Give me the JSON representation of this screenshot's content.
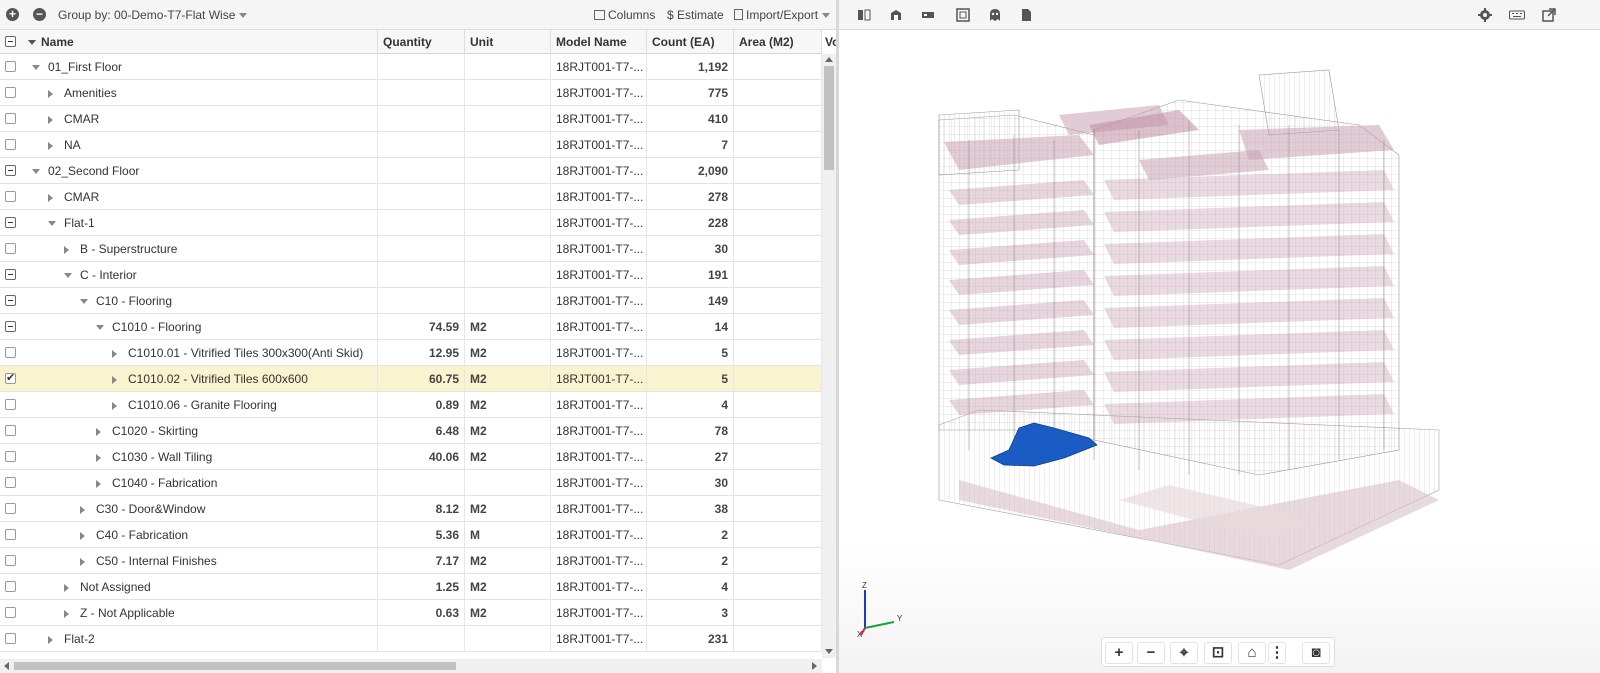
{
  "toolbar": {
    "group_by": "Group by: 00-Demo-T7-Flat Wise",
    "columns": "Columns",
    "estimate": "$ Estimate",
    "import_export": "Import/Export"
  },
  "headers": {
    "name": "Name",
    "quantity": "Quantity",
    "unit": "Unit",
    "model": "Model Name",
    "count": "Count (EA)",
    "area": "Area (M2)",
    "vol": "Vo"
  },
  "rows": [
    {
      "name": "01_First Floor",
      "qty": "",
      "unit": "",
      "model": "18RJT001-T7-...",
      "count": "1,192"
    },
    {
      "name": "Amenities",
      "qty": "",
      "unit": "",
      "model": "18RJT001-T7-...",
      "count": "775"
    },
    {
      "name": "CMAR",
      "qty": "",
      "unit": "",
      "model": "18RJT001-T7-...",
      "count": "410"
    },
    {
      "name": "NA",
      "qty": "",
      "unit": "",
      "model": "18RJT001-T7-...",
      "count": "7"
    },
    {
      "name": "02_Second Floor",
      "qty": "",
      "unit": "",
      "model": "18RJT001-T7-...",
      "count": "2,090"
    },
    {
      "name": "CMAR",
      "qty": "",
      "unit": "",
      "model": "18RJT001-T7-...",
      "count": "278"
    },
    {
      "name": "Flat-1",
      "qty": "",
      "unit": "",
      "model": "18RJT001-T7-...",
      "count": "228"
    },
    {
      "name": "B - Superstructure",
      "qty": "",
      "unit": "",
      "model": "18RJT001-T7-...",
      "count": "30"
    },
    {
      "name": "C - Interior",
      "qty": "",
      "unit": "",
      "model": "18RJT001-T7-...",
      "count": "191"
    },
    {
      "name": "C10 - Flooring",
      "qty": "",
      "unit": "",
      "model": "18RJT001-T7-...",
      "count": "149"
    },
    {
      "name": "C1010 - Flooring",
      "qty": "74.59",
      "unit": "M2",
      "model": "18RJT001-T7-...",
      "count": "14"
    },
    {
      "name": "C1010.01 - Vitrified Tiles 300x300(Anti Skid)",
      "qty": "12.95",
      "unit": "M2",
      "model": "18RJT001-T7-...",
      "count": "5"
    },
    {
      "name": "C1010.02 - Vitrified Tiles 600x600",
      "qty": "60.75",
      "unit": "M2",
      "model": "18RJT001-T7-...",
      "count": "5"
    },
    {
      "name": "C1010.06 - Granite Flooring",
      "qty": "0.89",
      "unit": "M2",
      "model": "18RJT001-T7-...",
      "count": "4"
    },
    {
      "name": "C1020 - Skirting",
      "qty": "6.48",
      "unit": "M2",
      "model": "18RJT001-T7-...",
      "count": "78"
    },
    {
      "name": "C1030 - Wall Tiling",
      "qty": "40.06",
      "unit": "M2",
      "model": "18RJT001-T7-...",
      "count": "27"
    },
    {
      "name": "C1040 - Fabrication",
      "qty": "",
      "unit": "",
      "model": "18RJT001-T7-...",
      "count": "30"
    },
    {
      "name": "C30 - Door&Window",
      "qty": "8.12",
      "unit": "M2",
      "model": "18RJT001-T7-...",
      "count": "38"
    },
    {
      "name": "C40 - Fabrication",
      "qty": "5.36",
      "unit": "M",
      "model": "18RJT001-T7-...",
      "count": "2"
    },
    {
      "name": "C50 - Internal Finishes",
      "qty": "7.17",
      "unit": "M2",
      "model": "18RJT001-T7-...",
      "count": "2"
    },
    {
      "name": "Not Assigned",
      "qty": "1.25",
      "unit": "M2",
      "model": "18RJT001-T7-...",
      "count": "4"
    },
    {
      "name": "Z - Not Applicable",
      "qty": "0.63",
      "unit": "M2",
      "model": "18RJT001-T7-...",
      "count": "3"
    },
    {
      "name": "Flat-2",
      "qty": "",
      "unit": "",
      "model": "18RJT001-T7-...",
      "count": "231"
    }
  ],
  "axes": {
    "z": "Z",
    "y": "Y",
    "x": "X"
  },
  "colors": {
    "selected_row": "#faf3cf",
    "highlight_element": "#1a5bc4",
    "building_tint": "#c9a3b3"
  },
  "viewer_tools": [
    "section-icon",
    "box-icon",
    "floor-icon",
    "sheet-icon",
    "ghost-icon",
    "document-icon",
    "settings-icon",
    "keyboard-icon",
    "popout-icon"
  ],
  "nav_tools": [
    "zoom-in-icon",
    "zoom-out-icon",
    "center-icon",
    "zoom-window-icon",
    "home-icon",
    "more-icon",
    "camera-icon"
  ]
}
